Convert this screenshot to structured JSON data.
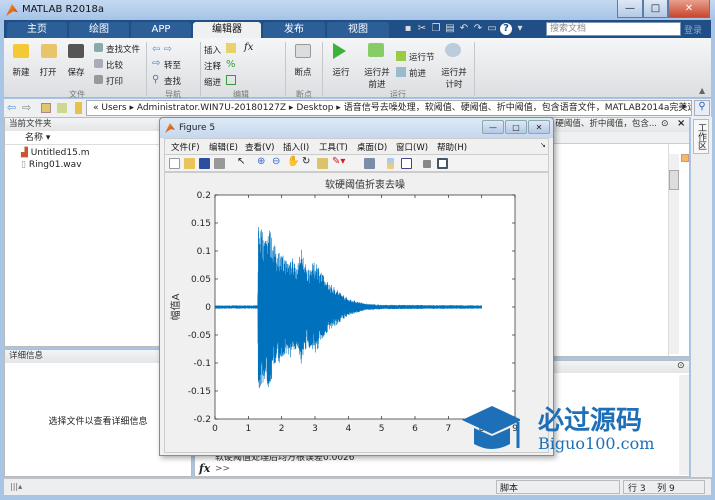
{
  "window": {
    "title": "MATLAB R2018a",
    "controls": [
      "—",
      "□",
      "✕"
    ]
  },
  "tabs": [
    {
      "label": "主页"
    },
    {
      "label": "绘图"
    },
    {
      "label": "APP"
    },
    {
      "label": "编辑器",
      "active": true
    },
    {
      "label": "发布"
    },
    {
      "label": "视图"
    }
  ],
  "search": {
    "placeholder": "搜索文档"
  },
  "login": "登录",
  "ribbon": {
    "file": {
      "new": "新建",
      "open": "打开",
      "save": "保存",
      "find_files": "查找文件",
      "compare": "比较",
      "print": "打印",
      "section": "文件"
    },
    "nav": {
      "goto": "转至",
      "find": "查找",
      "section": "导航"
    },
    "edit": {
      "insert": "插入",
      "comment": "注释",
      "indent": "缩进",
      "fx": "fx",
      "section": "编辑"
    },
    "breakpoints": {
      "label": "断点",
      "section": "断点"
    },
    "run": {
      "run": "运行",
      "run_advance": "运行并\n前进",
      "run_section": "运行节",
      "advance": "前进",
      "run_time": "运行并\n计时",
      "section": "运行"
    }
  },
  "address": {
    "segments": [
      "«",
      "Users",
      "Administrator.WIN7U-20180127Z",
      "Desktop",
      "语音信号去噪处理，软阈值、硬阈值、折中阈值，包含语音文件，MATLAB2014a完美运行"
    ]
  },
  "current_folder": {
    "title": "当前文件夹",
    "column": "名称",
    "files": [
      "Untitled15.m",
      "Ring01.wav"
    ]
  },
  "details": {
    "title": "详细信息",
    "message": "选择文件以查看详细信息"
  },
  "editor_tab": "硬阈值、折中阈值，包含...",
  "workspace_tab": "工作区",
  "command_window": {
    "output": "软硬阈值处理后均方根误差0.0026",
    "prompt": ">>",
    "fx": "fx"
  },
  "status": {
    "mode": "脚本",
    "row_label": "行",
    "row": "3",
    "col_label": "列",
    "col": "9"
  },
  "figure": {
    "title": "Figure 5",
    "menu": [
      "文件(F)",
      "编辑(E)",
      "查看(V)",
      "插入(I)",
      "工具(T)",
      "桌面(D)",
      "窗口(W)",
      "帮助(H)"
    ]
  },
  "chart_data": {
    "type": "line",
    "title": "软硬阈值折衷去噪",
    "xlabel": "",
    "ylabel": "幅值A",
    "xlim": [
      0,
      9
    ],
    "ylim": [
      -0.2,
      0.2
    ],
    "xticks": [
      "0",
      "1",
      "2",
      "3",
      "4",
      "5",
      "6",
      "7",
      "8",
      "9"
    ],
    "yticks": [
      "0.2",
      "0.15",
      "0.1",
      "0.05",
      "0",
      "-0.05",
      "-0.1",
      "-0.15",
      "-0.2"
    ],
    "color": "#0072bd",
    "signal_end": 8.0,
    "envelope": [
      [
        0,
        0.003
      ],
      [
        1.28,
        0.003
      ],
      [
        1.3,
        0.157
      ],
      [
        1.5,
        0.13
      ],
      [
        1.6,
        0.15
      ],
      [
        1.8,
        0.11
      ],
      [
        2.0,
        0.095
      ],
      [
        2.2,
        0.085
      ],
      [
        2.3,
        0.1
      ],
      [
        2.45,
        0.07
      ],
      [
        2.6,
        0.105
      ],
      [
        2.75,
        0.07
      ],
      [
        3.05,
        0.083
      ],
      [
        3.3,
        0.05
      ],
      [
        3.6,
        0.035
      ],
      [
        4.0,
        0.015
      ],
      [
        4.5,
        0.006
      ],
      [
        5.0,
        0.004
      ],
      [
        8.0,
        0.003
      ]
    ]
  },
  "watermark": {
    "text": "必过源码",
    "sub": "Biguo100.com"
  }
}
